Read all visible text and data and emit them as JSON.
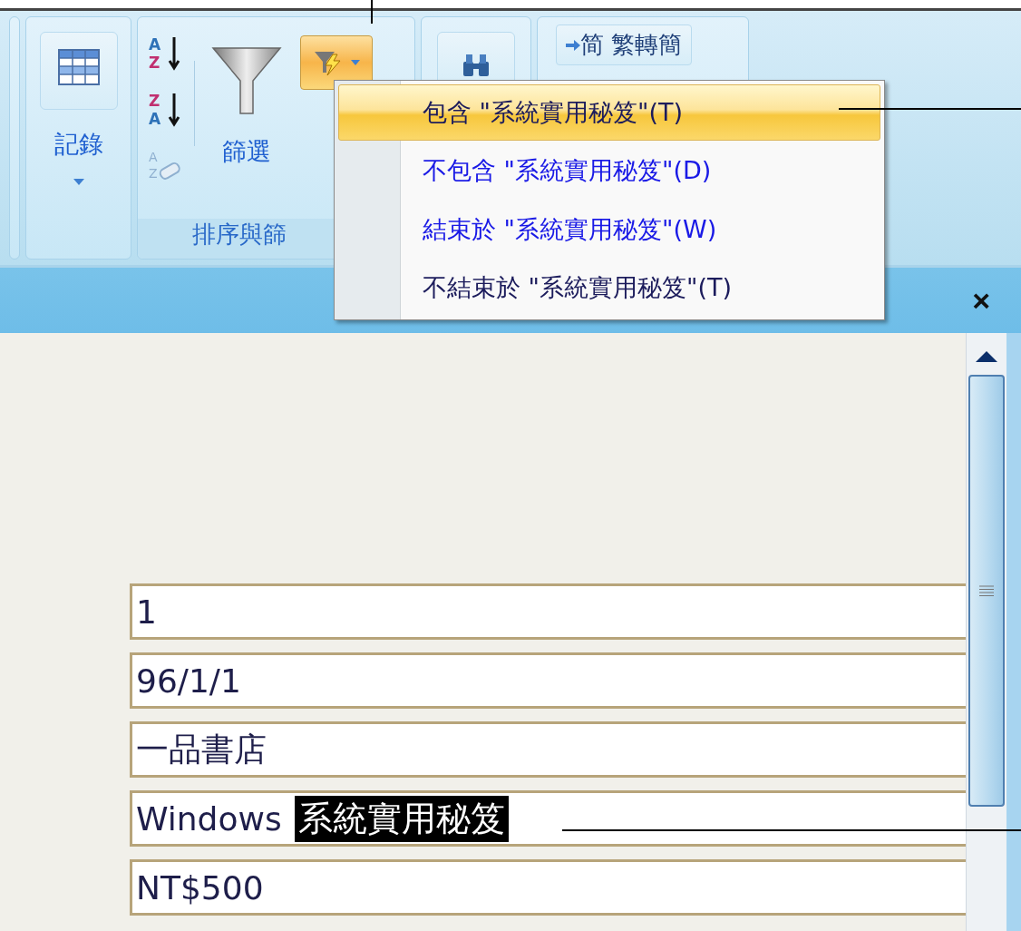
{
  "ribbon": {
    "records_group": {
      "label": "記錄"
    },
    "sort_filter_group": {
      "label": "排序與篩",
      "filter_label": "篩選",
      "sort_icons": [
        {
          "kind": "ascending",
          "top": "A",
          "bottom": "Z"
        },
        {
          "kind": "descending",
          "top": "Z",
          "bottom": "A"
        },
        {
          "kind": "clear",
          "top": "A",
          "bottom": "Z"
        }
      ]
    },
    "convert_group": {
      "icon_char": "简",
      "label": "繁轉簡"
    }
  },
  "filter_menu": {
    "items": [
      {
        "label": "包含 \"系統實用秘笈\"(T)",
        "selected": true,
        "color": "#1c1c5c"
      },
      {
        "label": "不包含 \"系統實用秘笈\"(D)",
        "selected": false,
        "color": "#1a1ae6"
      },
      {
        "label": "結束於 \"系統實用秘笈\"(W)",
        "selected": false,
        "color": "#1a1ae6"
      },
      {
        "label": "不結束於 \"系統實用秘笈\"(T)",
        "selected": false,
        "color": "#1c1c5c"
      }
    ]
  },
  "form_close": "×",
  "fields": [
    {
      "value": "1"
    },
    {
      "value": "96/1/1"
    },
    {
      "value": "一品書店"
    },
    {
      "value": "Windows",
      "highlighted": "系統實用秘笈"
    },
    {
      "value": "NT$500"
    }
  ]
}
